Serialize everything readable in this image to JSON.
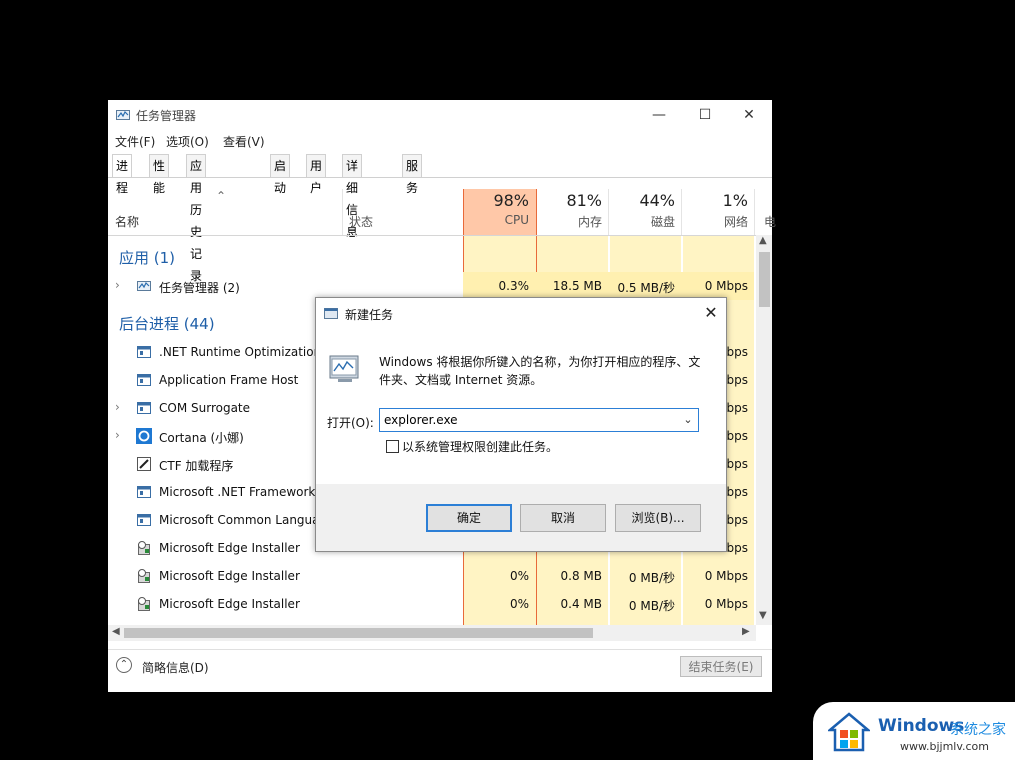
{
  "task_manager": {
    "title": "任务管理器",
    "menu": [
      "文件(F)",
      "选项(O)",
      "查看(V)"
    ],
    "tabs": [
      "进程",
      "性能",
      "应用历史记录",
      "启动",
      "用户",
      "详细信息",
      "服务"
    ],
    "columns": {
      "name": "名称",
      "status": "状态",
      "cpu_pct": "98%",
      "cpu_label": "CPU",
      "mem_pct": "81%",
      "mem_label": "内存",
      "disk_pct": "44%",
      "disk_label": "磁盘",
      "net_pct": "1%",
      "net_label": "网络",
      "extra_label": "电"
    },
    "groups": {
      "apps": "应用 (1)",
      "background": "后台进程 (44)"
    },
    "app_row": {
      "name": "任务管理器 (2)",
      "cpu": "0.3%",
      "mem": "18.5 MB",
      "disk": "0.5 MB/秒",
      "net": "0 Mbps"
    },
    "bg_rows": [
      {
        "name": ".NET Runtime Optimization",
        "net": "Mbps"
      },
      {
        "name": "Application Frame Host",
        "net": "Mbps"
      },
      {
        "name": "COM Surrogate",
        "net": "Mbps"
      },
      {
        "name": "Cortana (小娜)",
        "net": "Mbps"
      },
      {
        "name": "CTF 加载程序",
        "net": "Mbps"
      },
      {
        "name": "Microsoft .NET Framework",
        "net": "Mbps"
      },
      {
        "name": "Microsoft Common Langua",
        "net": "Mbps"
      },
      {
        "name": "Microsoft Edge Installer",
        "net": "Mbps"
      },
      {
        "name": "Microsoft Edge Installer",
        "cpu": "0%",
        "mem": "0.8 MB",
        "disk": "0 MB/秒",
        "net": "0 Mbps"
      },
      {
        "name": "Microsoft Edge Installer",
        "cpu": "0%",
        "mem": "0.4 MB",
        "disk": "0 MB/秒",
        "net": "0 Mbps"
      }
    ],
    "footer": {
      "fewer_details": "简略信息(D)",
      "end_task": "结束任务(E)"
    }
  },
  "run_dialog": {
    "title": "新建任务",
    "description": "Windows 将根据你所键入的名称，为你打开相应的程序、文件夹、文档或 Internet 资源。",
    "open_label": "打开(O):",
    "open_value": "explorer.exe",
    "admin_label": "以系统管理权限创建此任务。",
    "admin_checked": false,
    "ok": "确定",
    "cancel": "取消",
    "browse": "浏览(B)..."
  },
  "watermark": {
    "title": "Windows",
    "subtitle": "系统之家",
    "url": "www.bjjmlv.com"
  },
  "colors": {
    "accent": "#2c7fd6",
    "cpu_header": "#ffc8a8",
    "usage_fill": "#fff4c4",
    "group_text": "#1f5fa8"
  }
}
